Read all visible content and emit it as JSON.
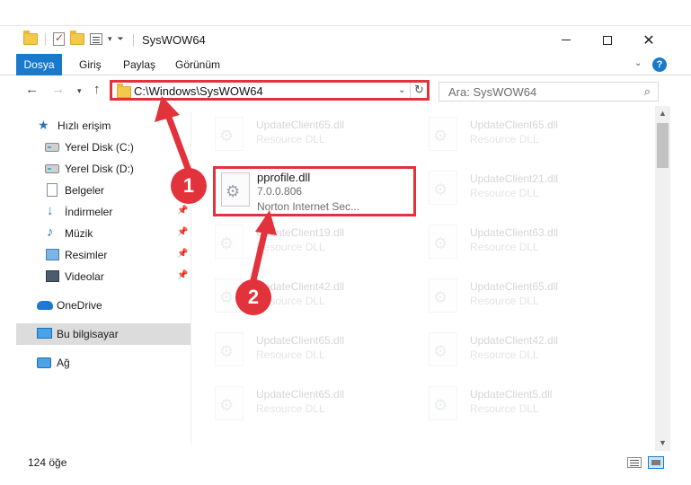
{
  "window": {
    "title": "SysWOW64",
    "controls": {
      "minimize": "",
      "maximize": "",
      "close": "✕"
    }
  },
  "ribbon": {
    "tabs": [
      "Dosya",
      "Giriş",
      "Paylaş",
      "Görünüm"
    ],
    "collapse_caret": "⌄",
    "help": "?"
  },
  "nav": {
    "back": "←",
    "forward": "→",
    "recent": "▾",
    "up": "↑",
    "address": "C:\\Windows\\SysWOW64",
    "address_caret": "⌄",
    "refresh": "↻",
    "search_placeholder": "Ara: SysWOW64",
    "search_icon": "⌕"
  },
  "sidebar": {
    "items": [
      {
        "label": "Hızlı erişim",
        "icon": "star-icon",
        "pinned": false
      },
      {
        "label": "Yerel Disk (C:)",
        "icon": "disk-icon",
        "pinned": false
      },
      {
        "label": "Yerel Disk (D:)",
        "icon": "disk-icon",
        "pinned": false
      },
      {
        "label": "Belgeler",
        "icon": "document-icon",
        "pinned": false
      },
      {
        "label": "İndirmeler",
        "icon": "download-icon",
        "pinned": true
      },
      {
        "label": "Müzik",
        "icon": "music-icon",
        "pinned": true
      },
      {
        "label": "Resimler",
        "icon": "pictures-icon",
        "pinned": true
      },
      {
        "label": "Videolar",
        "icon": "video-icon",
        "pinned": true
      },
      {
        "label": "OneDrive",
        "icon": "cloud-icon",
        "pinned": false
      },
      {
        "label": "Bu bilgisayar",
        "icon": "computer-icon",
        "pinned": false,
        "selected": true
      },
      {
        "label": "Ağ",
        "icon": "network-icon",
        "pinned": false
      }
    ],
    "pin_glyph": "📌"
  },
  "files": [
    {
      "name": "UpdateClient65.dll",
      "type": "Resource DLL"
    },
    {
      "name": "UpdateClient65.dll",
      "type": "Resource DLL"
    },
    {
      "name": "pprofile.dll",
      "version": "7.0.0.806",
      "company": "Norton Internet Sec...",
      "highlighted": true
    },
    {
      "name": "UpdateClient21.dll",
      "type": "Resource DLL"
    },
    {
      "name": "UpdateClient19.dll",
      "type": "Resource DLL"
    },
    {
      "name": "UpdateClient63.dll",
      "type": "Resource DLL"
    },
    {
      "name": "UpdateClient42.dll",
      "type": "Resource DLL"
    },
    {
      "name": "UpdateClient65.dll",
      "type": "Resource DLL"
    },
    {
      "name": "UpdateClient65.dll",
      "type": "Resource DLL"
    },
    {
      "name": "UpdateClient42.dll",
      "type": "Resource DLL"
    },
    {
      "name": "UpdateClient65.dll",
      "type": "Resource DLL"
    },
    {
      "name": "UpdateClient5.dll",
      "type": "Resource DLL"
    }
  ],
  "status": {
    "count": "124 öğe"
  },
  "callouts": [
    "1",
    "2"
  ],
  "colors": {
    "accent": "#1979ca",
    "highlight": "#e2323c"
  }
}
